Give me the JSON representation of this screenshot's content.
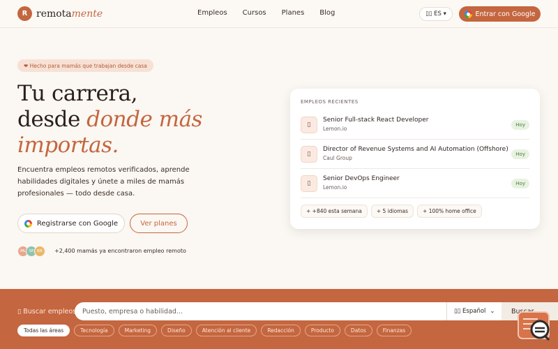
{
  "nav": {
    "logo_mark": "R",
    "logo_text_1": "remota",
    "logo_text_2": "mente",
    "links": [
      "Empleos",
      "Cursos",
      "Planes",
      "Blog"
    ],
    "lang": "ES",
    "lang_flag": "▯▯",
    "google_cta": "Entrar con Google"
  },
  "hero": {
    "badge": "❤ Hecho para mamás que trabajan desde casa",
    "title_1": "Tu carrera,",
    "title_2": "desde ",
    "title_em_1": "donde más",
    "title_em_2": "importas.",
    "subtitle": "Encuentra empleos remotos verificados, aprende habilidades digitales y únete a miles de mamás profesionales — todo desde casa.",
    "register_btn": "Registrarse con Google",
    "plans_btn": "Ver planes",
    "avatars": [
      {
        "initials": "ML",
        "color": "#e8a78c"
      },
      {
        "initials": "SP",
        "color": "#8fc3b0"
      },
      {
        "initials": "KR",
        "color": "#e9b86a"
      }
    ],
    "social_proof": "+2,400 mamás ya encontraron empleo remoto"
  },
  "card": {
    "label": "EMPLEOS RECIENTES",
    "jobs": [
      {
        "icon": "▯",
        "title": "Senior Full-stack React Developer",
        "company": "Lemon.io",
        "tag": "Hoy"
      },
      {
        "icon": "▯",
        "title": "Director of Revenue Systems and AI Automation (Offshore)",
        "company": "Caul Group",
        "tag": "Hoy"
      },
      {
        "icon": "▯",
        "title": "Senior DevOps Engineer",
        "company": "Lemon.io",
        "tag": "Hoy"
      }
    ],
    "stats": [
      "+ +840 esta semana",
      "+ 5 idiomas",
      "+ 100% home office"
    ]
  },
  "search": {
    "label": "▯ Buscar empleos:",
    "placeholder": "Puesto, empresa o habilidad...",
    "lang_select": "▯▯ Español",
    "button": "Buscar",
    "chips": [
      "Todas las áreas",
      "Tecnología",
      "Marketing",
      "Diseño",
      "Atención al cliente",
      "Redacción",
      "Producto",
      "Datos",
      "Finanzas"
    ]
  }
}
